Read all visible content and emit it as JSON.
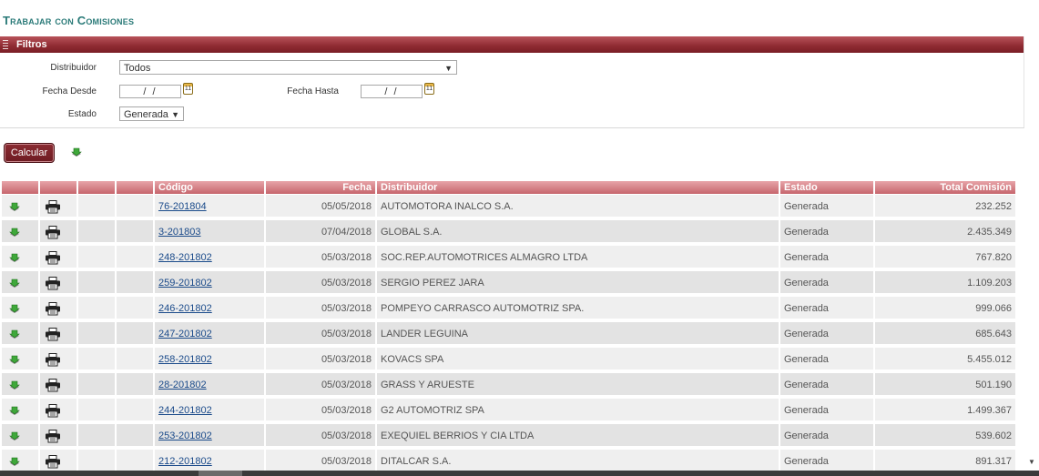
{
  "page_title": "Trabajar con Comisiones",
  "filters": {
    "header": "Filtros",
    "distribuidor_label": "Distribuidor",
    "distribuidor_value": "Todos",
    "fecha_desde_label": "Fecha Desde",
    "fecha_desde_value": "/ /",
    "fecha_hasta_label": "Fecha Hasta",
    "fecha_hasta_value": "/ /",
    "estado_label": "Estado",
    "estado_value": "Generada",
    "calendar_icon_text": "11"
  },
  "actions": {
    "calcular_label": "Calcular",
    "export_icon": "excel-export-icon"
  },
  "table": {
    "headers": [
      "",
      "",
      "",
      "",
      "Código",
      "Fecha",
      "Distribuidor",
      "Estado",
      "Total Comisión"
    ],
    "rows": [
      {
        "codigo": "76-201804",
        "fecha": "05/05/2018",
        "distribuidor": "AUTOMOTORA INALCO S.A.",
        "estado": "Generada",
        "total": "232.252"
      },
      {
        "codigo": "3-201803",
        "fecha": "07/04/2018",
        "distribuidor": "GLOBAL S.A.",
        "estado": "Generada",
        "total": "2.435.349"
      },
      {
        "codigo": "248-201802",
        "fecha": "05/03/2018",
        "distribuidor": "SOC.REP.AUTOMOTRICES ALMAGRO LTDA",
        "estado": "Generada",
        "total": "767.820"
      },
      {
        "codigo": "259-201802",
        "fecha": "05/03/2018",
        "distribuidor": "SERGIO PEREZ JARA",
        "estado": "Generada",
        "total": "1.109.203"
      },
      {
        "codigo": "246-201802",
        "fecha": "05/03/2018",
        "distribuidor": "POMPEYO CARRASCO AUTOMOTRIZ SPA.",
        "estado": "Generada",
        "total": "999.066"
      },
      {
        "codigo": "247-201802",
        "fecha": "05/03/2018",
        "distribuidor": "LANDER LEGUINA",
        "estado": "Generada",
        "total": "685.643"
      },
      {
        "codigo": "258-201802",
        "fecha": "05/03/2018",
        "distribuidor": "KOVACS SPA",
        "estado": "Generada",
        "total": "5.455.012"
      },
      {
        "codigo": "28-201802",
        "fecha": "05/03/2018",
        "distribuidor": "GRASS Y ARUESTE",
        "estado": "Generada",
        "total": "501.190"
      },
      {
        "codigo": "244-201802",
        "fecha": "05/03/2018",
        "distribuidor": "G2 AUTOMOTRIZ SPA",
        "estado": "Generada",
        "total": "1.499.367"
      },
      {
        "codigo": "253-201802",
        "fecha": "05/03/2018",
        "distribuidor": "EXEQUIEL BERRIOS Y CIA LTDA",
        "estado": "Generada",
        "total": "539.602"
      },
      {
        "codigo": "212-201802",
        "fecha": "05/03/2018",
        "distribuidor": "DITALCAR S.A.",
        "estado": "Generada",
        "total": "891.317"
      }
    ]
  },
  "colors": {
    "brand": "#8e2a31",
    "title": "#2a7a78",
    "header_row": "#c6666d"
  }
}
